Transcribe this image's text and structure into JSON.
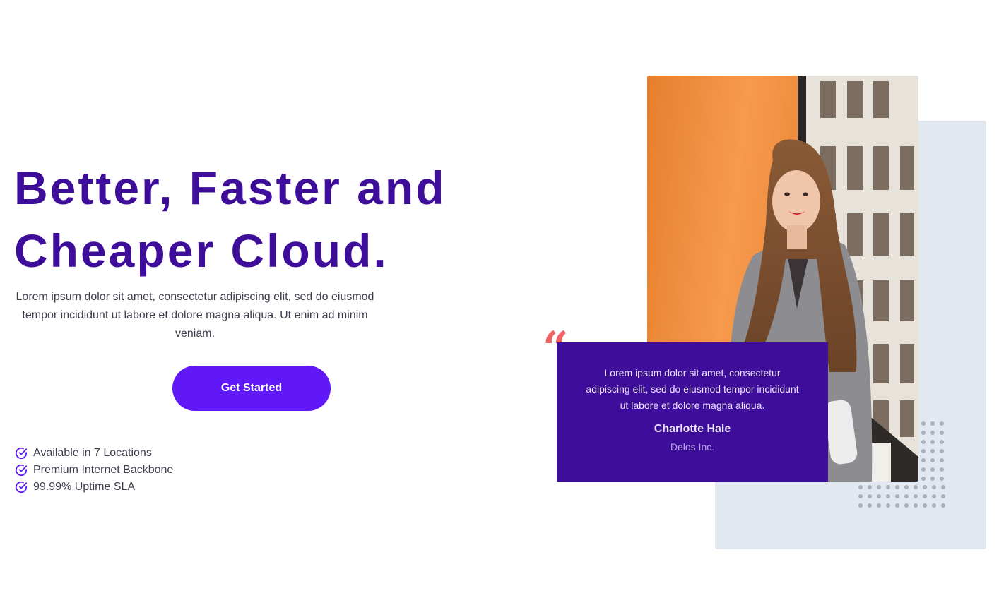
{
  "hero": {
    "title_line_1": "Better, Faster and",
    "title_line_2": "Cheaper Cloud.",
    "description": "Lorem ipsum dolor sit amet, consectetur adipiscing elit, sed do eiusmod tempor incididunt ut labore et dolore magna aliqua. Ut enim ad minim veniam.",
    "cta_label": "Get Started"
  },
  "features": [
    {
      "label": "Available in 7 Locations",
      "icon": "check-circle-icon"
    },
    {
      "label": "Premium Internet Backbone",
      "icon": "check-circle-icon"
    },
    {
      "label": "99.99% Uptime SLA",
      "icon": "check-circle-icon"
    }
  ],
  "testimonial": {
    "quote_mark": "“",
    "quote": "Lorem ipsum dolor sit amet, consectetur adipiscing elit, sed do eiusmod tempor incididunt ut labore et dolore magna aliqua.",
    "name": "Charlotte Hale",
    "company": "Delos Inc."
  },
  "colors": {
    "brand_dark": "#3e0e9a",
    "brand_button": "#6018f9",
    "quote_accent": "#f06265",
    "panel_bg": "#e2e8f0"
  }
}
